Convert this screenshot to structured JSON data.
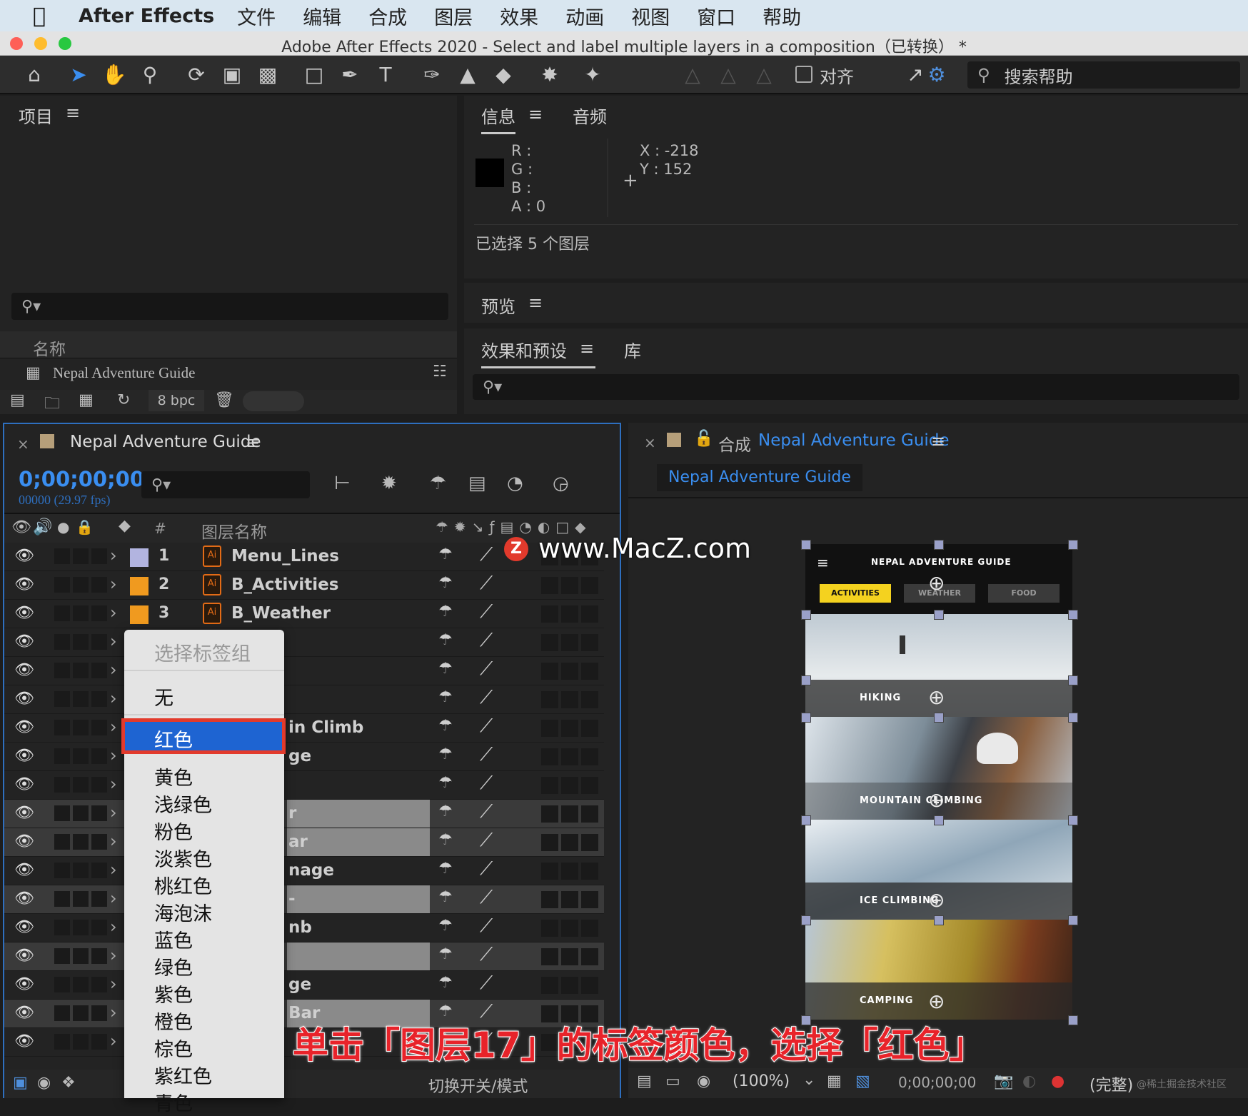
{
  "menubar": {
    "app": "After Effects",
    "items": [
      "文件",
      "编辑",
      "合成",
      "图层",
      "效果",
      "动画",
      "视图",
      "窗口",
      "帮助"
    ]
  },
  "window": {
    "title": "Adobe After Effects 2020 - Select and label multiple layers in a composition（已转换） *"
  },
  "toolbar": {
    "align_label": "对齐",
    "search_help": "搜索帮助"
  },
  "project_panel": {
    "title": "项目",
    "col_name": "名称",
    "item": "Nepal Adventure Guide",
    "bpc": "8 bpc"
  },
  "info_panel": {
    "tab_info": "信息",
    "tab_audio": "音频",
    "r": "R :",
    "g": "G :",
    "b": "B :",
    "a": "A :  0",
    "x": "X : -218",
    "y": "Y :  152",
    "status": "已选择 5 个图层"
  },
  "preview_panel": {
    "title": "预览"
  },
  "effects_panel": {
    "tab_effects": "效果和预设",
    "tab_library": "库"
  },
  "timeline": {
    "comp_name": "Nepal Adventure Guide",
    "timecode": "0;00;00;00",
    "frames": "00000 (29.97 fps)",
    "col_num": "#",
    "col_layer_name": "图层名称",
    "footer_label": "切换开关/模式",
    "layers": [
      {
        "num": "1",
        "name": "Menu_Lines",
        "label_color": "#b2b4e0"
      },
      {
        "num": "2",
        "name": "B_Activities",
        "label_color": "#f09a1f"
      },
      {
        "num": "3",
        "name": "B_Weather",
        "label_color": "#f09a1f"
      }
    ],
    "partial_names": [
      {
        "row": 6,
        "text": "in Climb"
      },
      {
        "row": 7,
        "text": "ge"
      },
      {
        "row": 9,
        "text": "r"
      },
      {
        "row": 10,
        "text": "ar"
      },
      {
        "row": 11,
        "text": "nage"
      },
      {
        "row": 12,
        "text": "-"
      },
      {
        "row": 13,
        "text": "nb"
      },
      {
        "row": 15,
        "text": "ge"
      },
      {
        "row": 16,
        "text": "Bar"
      }
    ]
  },
  "context_menu": {
    "header": "选择标签组",
    "none": "无",
    "selected": "红色",
    "items": [
      "黄色",
      "浅绿色",
      "粉色",
      "淡紫色",
      "桃红色",
      "海泡沫",
      "蓝色",
      "绿色",
      "紫色",
      "橙色",
      "棕色",
      "紫红色",
      "青色"
    ]
  },
  "comp_viewer": {
    "prefix": "合成",
    "name": "Nepal Adventure Guide",
    "tab": "Nepal Adventure Guide",
    "zoom": "(100%)",
    "timecode": "0;00;00;00",
    "quality": "(完整)",
    "app_title": "NEPAL ADVENTURE GUIDE",
    "app_tabs": [
      "ACTIVITIES",
      "WEATHER",
      "FOOD"
    ],
    "sections": [
      "HIKING",
      "MOUNTAIN CLIMBING",
      "ICE CLIMBING",
      "CAMPING"
    ]
  },
  "watermark": "www.MacZ.com",
  "caption": "单击「图层17」的标签颜色，选择「红色」",
  "corner_watermark": "@稀土掘金技术社区",
  "colors": {
    "accent_blue": "#3a8ef0",
    "highlight": "#1e64d2",
    "caption_red": "#e8232a",
    "app_yellow": "#f4d21f"
  }
}
